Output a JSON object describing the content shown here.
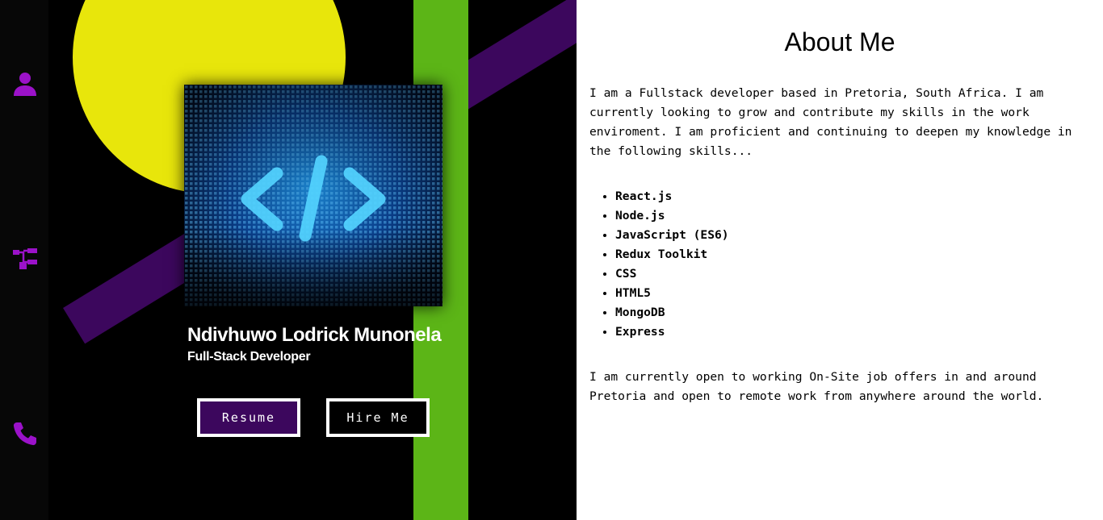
{
  "nav": {
    "items": [
      {
        "icon": "user-icon"
      },
      {
        "icon": "sitemap-icon"
      },
      {
        "icon": "phone-icon"
      }
    ],
    "accent_color": "#9b12c9"
  },
  "hero": {
    "name": "Ndivhuwo Lodrick Munonela",
    "role": "Full-Stack Developer",
    "resume_label": "Resume",
    "hire_label": "Hire Me",
    "image_icon": "code-icon",
    "colors": {
      "circle": "#e8e60b",
      "band": "#3c075d",
      "bar": "#5cb517",
      "background": "#000000"
    }
  },
  "about": {
    "title": "About Me",
    "intro": "I am a Fullstack developer based in Pretoria, South Africa. I am currently looking to grow and contribute my skills in the work enviroment. I am proficient and continuing to deepen my knowledge in the following skills...",
    "skills": [
      "React.js",
      "Node.js",
      "JavaScript (ES6)",
      "Redux Toolkit",
      "CSS",
      "HTML5",
      "MongoDB",
      "Express"
    ],
    "outro": "I am currently open to working On-Site job offers in and around Pretoria and open to remote work from anywhere around the world."
  }
}
